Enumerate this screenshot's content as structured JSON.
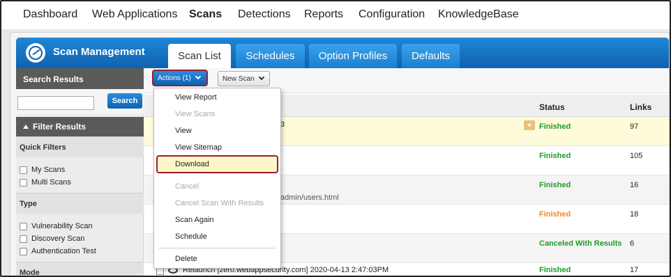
{
  "topnav": {
    "items": [
      "Dashboard",
      "Web Applications",
      "Scans",
      "Detections",
      "Reports",
      "Configuration",
      "KnowledgeBase"
    ],
    "active": "Scans"
  },
  "header": {
    "title": "Scan Management",
    "tabs": [
      "Scan List",
      "Schedules",
      "Option Profiles",
      "Defaults"
    ],
    "active_tab": "Scan List"
  },
  "sidebar": {
    "search_results_label": "Search Results",
    "search_button": "Search",
    "search_value": "",
    "filter_results_label": "Filter Results",
    "quick_filters_label": "Quick Filters",
    "quick_filters": [
      "My Scans",
      "Multi Scans"
    ],
    "type_label": "Type",
    "types": [
      "Vulnerability Scan",
      "Discovery Scan",
      "Authentication Test"
    ],
    "mode_label": "Mode"
  },
  "toolbar": {
    "actions_label": "Actions (1)",
    "new_scan_label": "New Scan"
  },
  "table": {
    "columns": {
      "status": "Status",
      "links": "Links"
    },
    "rows": [
      {
        "fragment": "3",
        "status": "Finished",
        "status_color": "#1c9c2a",
        "links": "97"
      },
      {
        "fragment": "",
        "status": "Finished",
        "status_color": "#1c9c2a",
        "links": "105"
      },
      {
        "fragment": "admin/users.html",
        "status": "Finished",
        "status_color": "#1c9c2a",
        "links": "16"
      },
      {
        "fragment": "",
        "status": "Finished",
        "status_color": "#f0882b",
        "links": "18"
      },
      {
        "fragment": "",
        "status": "Canceled With Results",
        "status_color": "#1c9c2a",
        "links": "6"
      }
    ],
    "last_row": {
      "title": "Relaunch [zero.webappsecurity.com] 2020-04-13 2:47:03PM",
      "status": "Finished",
      "status_color": "#1c9c2a",
      "links": "17"
    }
  },
  "actions_menu": {
    "view_report": "View Report",
    "view_scans": "View Scans",
    "view": "View",
    "view_sitemap": "View Sitemap",
    "download": "Download",
    "cancel": "Cancel",
    "cancel_with_results": "Cancel Scan With Results",
    "scan_again": "Scan Again",
    "schedule": "Schedule",
    "delete": "Delete"
  },
  "colors": {
    "brand_blue": "#0f62b0",
    "highlight_border": "#9b1c2e",
    "status_green": "#1c9c2a",
    "status_orange": "#f0882b"
  }
}
